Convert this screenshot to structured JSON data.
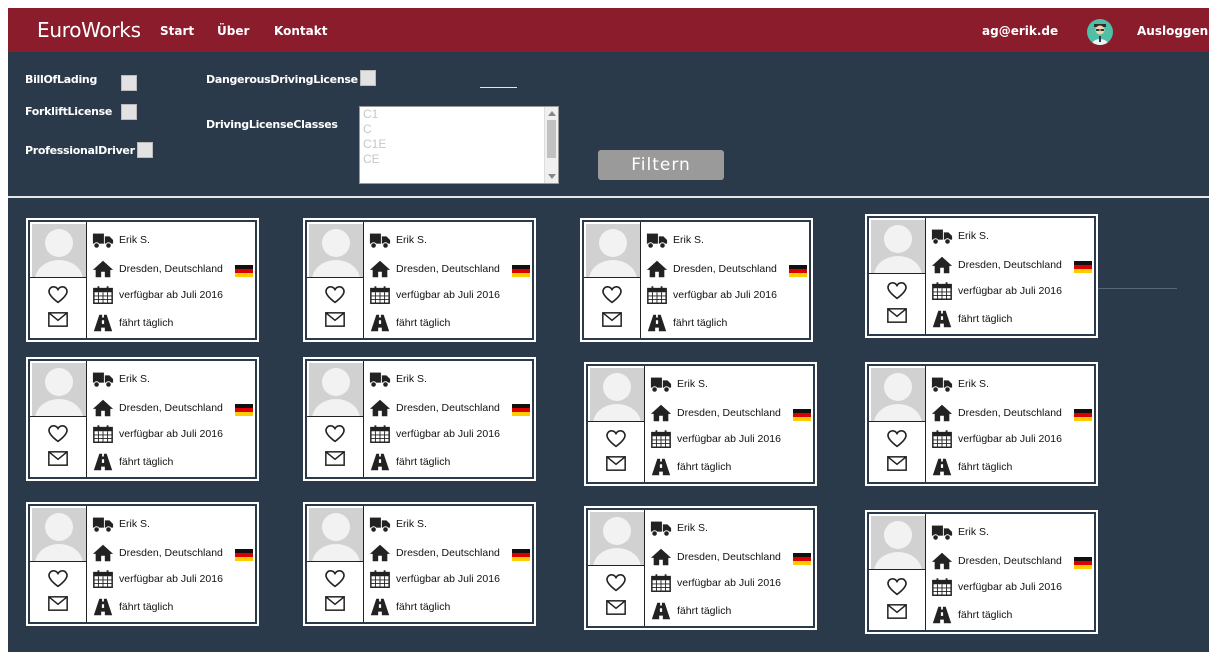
{
  "navbar": {
    "brand": "EuroWorks",
    "links": [
      "Start",
      "Über",
      "Kontakt"
    ],
    "user_email": "ag@erik.de",
    "logout": "Ausloggen"
  },
  "filter": {
    "checkbox_bill_of_lading": "BillOfLading",
    "checkbox_forklift_license": "ForkliftLicense",
    "checkbox_professional_driver": "ProfessionalDriver",
    "checkbox_dangerous_driving_license": "DangerousDrivingLicense",
    "driving_license_classes_label": "DrivingLicenseClasses",
    "driving_license_classes_options": [
      "C1",
      "C",
      "C1E",
      "CE"
    ],
    "filter_button": "Filtern"
  },
  "card_template": {
    "name": "Erik S.",
    "location": "Dresden, Deutschland",
    "availability": "verfügbar ab Juli 2016",
    "frequency": "fährt täglich"
  },
  "colors": {
    "navbar": "#8b1c2c",
    "background": "#2b3a4a",
    "card": "#ffffff",
    "filter_button": "#9a9a9a"
  },
  "icons": {
    "truck": "truck-icon",
    "home": "home-icon",
    "calendar": "calendar-icon",
    "road": "road-icon",
    "heart": "heart-icon",
    "mail": "mail-icon",
    "flag": "german-flag-icon"
  }
}
